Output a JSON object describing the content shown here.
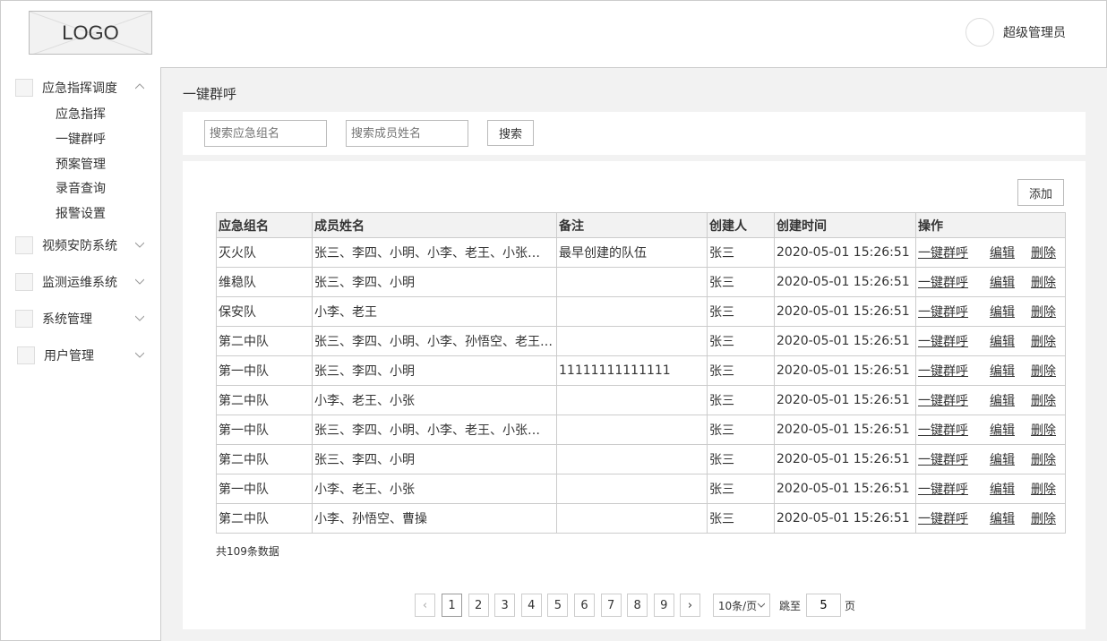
{
  "header": {
    "logo_text": "LOGO",
    "user_name": "超级管理员"
  },
  "sidebar": {
    "groups": [
      {
        "label": "应急指挥调度",
        "expanded": true,
        "items": [
          "应急指挥",
          "一键群呼",
          "预案管理",
          "录音查询",
          "报警设置"
        ]
      },
      {
        "label": "视频安防系统",
        "expanded": false
      },
      {
        "label": "监测运维系统",
        "expanded": false
      },
      {
        "label": "系统管理",
        "expanded": false
      },
      {
        "label": "用户管理",
        "expanded": false
      }
    ]
  },
  "page": {
    "title": "一键群呼"
  },
  "search": {
    "group_placeholder": "搜索应急组名",
    "member_placeholder": "搜索成员姓名",
    "button": "搜索"
  },
  "toolbar": {
    "add_label": "添加"
  },
  "table": {
    "columns": [
      "应急组名",
      "成员姓名",
      "备注",
      "创建人",
      "创建时间",
      "操作"
    ],
    "ops": {
      "call": "一键群呼",
      "edit": "编辑",
      "delete": "删除"
    },
    "rows": [
      [
        "灭火队",
        "张三、李四、小明、小李、老王、小张…",
        "最早创建的队伍",
        "张三",
        "2020-05-01 15:26:51"
      ],
      [
        "维稳队",
        "张三、李四、小明",
        "",
        "张三",
        "2020-05-01 15:26:51"
      ],
      [
        "保安队",
        "小李、老王",
        "",
        "张三",
        "2020-05-01 15:26:51"
      ],
      [
        "第二中队",
        "张三、李四、小明、小李、孙悟空、老王…",
        "",
        "张三",
        "2020-05-01 15:26:51"
      ],
      [
        "第一中队",
        "张三、李四、小明",
        "11111111111111",
        "张三",
        "2020-05-01 15:26:51"
      ],
      [
        "第二中队",
        "小李、老王、小张",
        "",
        "张三",
        "2020-05-01 15:26:51"
      ],
      [
        "第一中队",
        "张三、李四、小明、小李、老王、小张…",
        "",
        "张三",
        "2020-05-01 15:26:51"
      ],
      [
        "第二中队",
        "张三、李四、小明",
        "",
        "张三",
        "2020-05-01 15:26:51"
      ],
      [
        "第一中队",
        "小李、老王、小张",
        "",
        "张三",
        "2020-05-01 15:26:51"
      ],
      [
        "第二中队",
        "小李、孙悟空、曹操",
        "",
        "张三",
        "2020-05-01 15:26:51"
      ]
    ]
  },
  "footer": {
    "total_text": "共109条数据"
  },
  "pagination": {
    "prev": "‹",
    "next": "›",
    "pages": [
      "1",
      "2",
      "3",
      "4",
      "5",
      "6",
      "7",
      "8",
      "9"
    ],
    "current": "1",
    "page_size": "10条/页",
    "jump_label": "跳至",
    "jump_value": "5",
    "page_unit": "页"
  }
}
